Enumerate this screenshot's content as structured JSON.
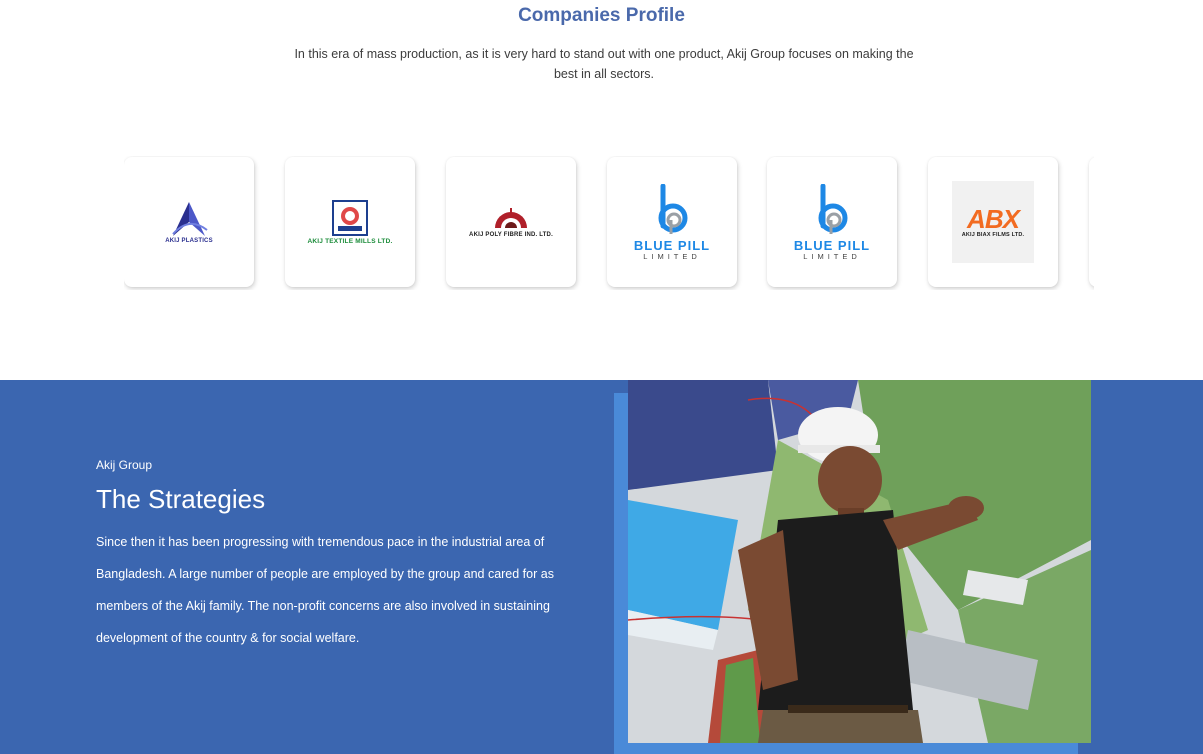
{
  "profile": {
    "title": "Companies Profile",
    "description": "In this era of mass production, as it is very hard to stand out with one product, Akij Group focuses on making the best in all sectors."
  },
  "companies": [
    {
      "logo_text": "AKIJ PLASTICS",
      "icon": "akij-plastics-logo"
    },
    {
      "logo_text": "AKIJ TEXTILE MILLS LTD.",
      "icon": "akij-textile-logo"
    },
    {
      "logo_text": "AKIJ POLY FIBRE IND. LTD.",
      "icon": "akij-poly-fibre-logo"
    },
    {
      "logo_text": "BLUE PILL",
      "logo_sub": "LIMITED",
      "icon": "blue-pill-logo"
    },
    {
      "logo_text": "BLUE PILL",
      "logo_sub": "LIMITED",
      "icon": "blue-pill-logo"
    },
    {
      "logo_text": "AKIJ BIAX FILMS LTD.",
      "logo_mark": "ABX",
      "icon": "abx-logo"
    }
  ],
  "strategy": {
    "eyebrow": "Akij Group",
    "title": "The Strategies",
    "body": "Since then it has been progressing with tremendous pace in the industrial area of Bangladesh. A large number of people are employed by the group and cared for as members of the Akij family. The non-profit concerns are also involved in sustaining development of the country & for social welfare."
  },
  "colors": {
    "title_blue": "#4a69ab",
    "section_blue": "#3b66b0",
    "accent_blue": "#4a8ad8",
    "bluepill_blue": "#1e88e5",
    "abx_orange": "#f26b21"
  }
}
